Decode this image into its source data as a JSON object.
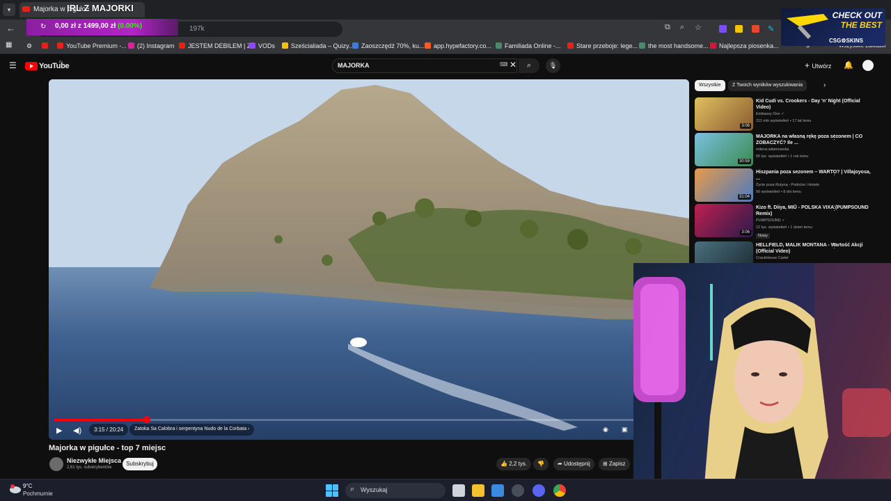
{
  "overlays": {
    "stream_title": "IRL Z MAJORKI",
    "donation_amount": "0,00 zł z 1499,00 zł",
    "donation_percent": "(0.00%)",
    "ad_line1": "CHECK OUT",
    "ad_line2": "THE BEST",
    "ad_brand": "CSG⚙SKINS"
  },
  "browser": {
    "tab_title": "Majorka w pigułce",
    "url_fragment": "197k",
    "bookmarks": [
      {
        "label": "YouTube Premium -...",
        "color": "#e62117"
      },
      {
        "label": "(2) Instagram",
        "color": "#d6249f"
      },
      {
        "label": "JESTEM DEBILEM | Z...",
        "color": "#e62117"
      },
      {
        "label": "VODs",
        "color": "#9146ff"
      },
      {
        "label": "Sześcialiada – Quizy...",
        "color": "#f5c400"
      },
      {
        "label": "Zaoszczędź 70%, ku...",
        "color": "#3d7bd9"
      },
      {
        "label": "app.hypefactory.co...",
        "color": "#ff5a1f"
      },
      {
        "label": "Familiada Online -...",
        "color": "#4a8a6a"
      },
      {
        "label": "Stare przeboje: lege...",
        "color": "#e62117"
      },
      {
        "label": "the most handsome...",
        "color": "#4a8a6a"
      },
      {
        "label": "Najlepsza piosenka...",
        "color": "#c41e3a"
      }
    ],
    "all_bookmarks": "Wszystkie zakładki"
  },
  "youtube": {
    "logo": "YouTube",
    "logo_region": "PL",
    "search_query": "MAJORKA",
    "create_label": "Utwórz",
    "video": {
      "title": "Majorka w pigułce - top 7 miejsc",
      "time": "3:15 / 20:24",
      "chapter": "Zatoka Sa Calobra i serpentyna Nudo de la Corbata",
      "progress": 0.16,
      "channel": "Niezwykłe Miejsca",
      "subscribers": "2,61 tys. subskrybentów",
      "subscribe": "Subskrybuj",
      "likes": "2,2 tys.",
      "share": "Udostępnij",
      "save": "Zapisz"
    },
    "chips": [
      "Wszystkie",
      "Z Twoich wyników wyszukiwania"
    ],
    "recommendations": [
      {
        "title": "Kid Cudi vs. Crookers - Day 'n' Night (Official Video)",
        "channel": "Embassy One ✓",
        "views": "211 mln wyświetleń • 17 lat temu",
        "duration": "3:06",
        "thumb": "#c8a040"
      },
      {
        "title": "MAJORKA na własną rękę poza sezonem | CO ZOBACZYĆ? Ile ...",
        "channel": "milena.wilamowska",
        "views": "55 tys. wyświetleń • 1 rok temu",
        "duration": "30:59",
        "thumb": "#4aa0c8"
      },
      {
        "title": "Hiszpania poza sezonem – WARTO? | Villajoyosa, ...",
        "channel": "Życie poza Rutyną - Podróże i Hotele",
        "views": "56 wyświetleń • 8 dni temu",
        "duration": "31:04",
        "thumb": "#d87a3a"
      },
      {
        "title": "Kizo ft. Diiya, MIŪ - POLSKA VIXA (PUMPSOUND Remix)",
        "channel": "PUMPSOUND ✓",
        "views": "12 tys. wyświetleń • 1 dzień temu",
        "duration": "3:06",
        "thumb": "#b02050",
        "badge": "Nowy"
      },
      {
        "title": "HELLFIELD, MALIK MONTANA - Wartość Akcji (Official Video)",
        "channel": "CrackHouse Cartel",
        "views": "",
        "duration": "",
        "thumb": "#3a6070"
      }
    ]
  },
  "taskbar": {
    "temperature": "9°C",
    "weather": "Pochmurnie",
    "search": "Wyszukaj"
  }
}
